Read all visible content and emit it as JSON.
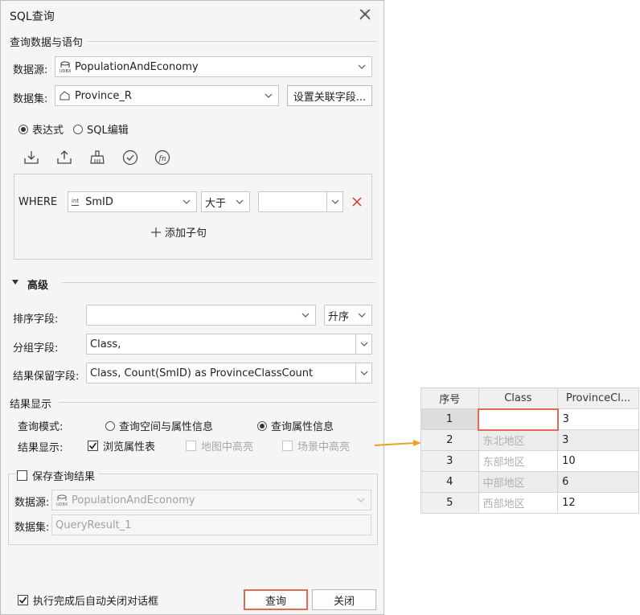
{
  "dialog": {
    "title": "SQL查询",
    "query_group_label": "查询数据与语句",
    "datasource_label": "数据源:",
    "datasource_value": "PopulationAndEconomy",
    "dataset_label": "数据集:",
    "dataset_value": "Province_R",
    "relate_fields_button": "设置关联字段...",
    "mode_expression": "表达式",
    "mode_sql": "SQL编辑",
    "where_keyword": "WHERE",
    "field_type_tag": "int",
    "field_value": "SmID",
    "operator_value": "大于",
    "operand_value": "",
    "add_clause_label": "添加子句",
    "advanced_label": "高级",
    "sort_label": "排序字段:",
    "sort_value": "",
    "sort_order": "升序",
    "group_label": "分组字段:",
    "group_value": "Class,",
    "keep_label": "结果保留字段:",
    "keep_value": "Class, Count(SmID) as ProvinceClassCount",
    "result_group_label": "结果显示",
    "query_mode_label": "查询模式:",
    "query_mode_spatial": "查询空间与属性信息",
    "query_mode_attr": "查询属性信息",
    "result_show_label": "结果显示:",
    "browse_attr": "浏览属性表",
    "map_highlight": "地图中高亮",
    "scene_highlight": "场景中高亮",
    "save_result_label": "保存查询结果",
    "save_datasource_label": "数据源:",
    "save_datasource_value": "PopulationAndEconomy",
    "save_dataset_label": "数据集:",
    "save_dataset_value": "QueryResult_1",
    "auto_close_label": "执行完成后自动关闭对话框",
    "query_button": "查询",
    "close_button": "关闭"
  },
  "result_table": {
    "headers": [
      "序号",
      "Class",
      "ProvinceCl..."
    ],
    "rows": [
      {
        "n": "1",
        "class": "",
        "count": "3"
      },
      {
        "n": "2",
        "class": "东北地区",
        "count": "3"
      },
      {
        "n": "3",
        "class": "东部地区",
        "count": "10"
      },
      {
        "n": "4",
        "class": "中部地区",
        "count": "6"
      },
      {
        "n": "5",
        "class": "西部地区",
        "count": "12"
      }
    ]
  },
  "colors": {
    "accent_border": "#e06a55",
    "arrow": "#f0a020",
    "delete_x": "#e03030"
  }
}
